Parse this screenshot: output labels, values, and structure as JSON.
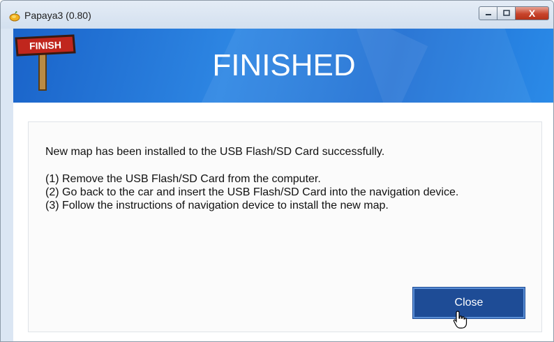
{
  "window": {
    "title": "Papaya3 (0.80)",
    "app_icon": "papaya-icon",
    "controls": {
      "minimize": "minimize-icon",
      "maximize": "maximize-icon",
      "close_glyph": "X"
    }
  },
  "banner": {
    "title": "FINISHED",
    "sign_text": "FINISH",
    "sign_icon": "finish-signpost-icon"
  },
  "content": {
    "lines": [
      "New map has been installed to the USB Flash/SD Card successfully.",
      "(1) Remove the USB Flash/SD Card from the computer.",
      "(2) Go back to the car and insert the USB Flash/SD Card into the navigation device.",
      "(3) Follow the instructions of navigation device to install the new map."
    ],
    "close_label": "Close"
  },
  "colors": {
    "banner_blue": "#1f6fd3",
    "button_blue": "#1e4c96",
    "sign_red": "#b8241c"
  },
  "cursor": "hand-pointer-icon"
}
